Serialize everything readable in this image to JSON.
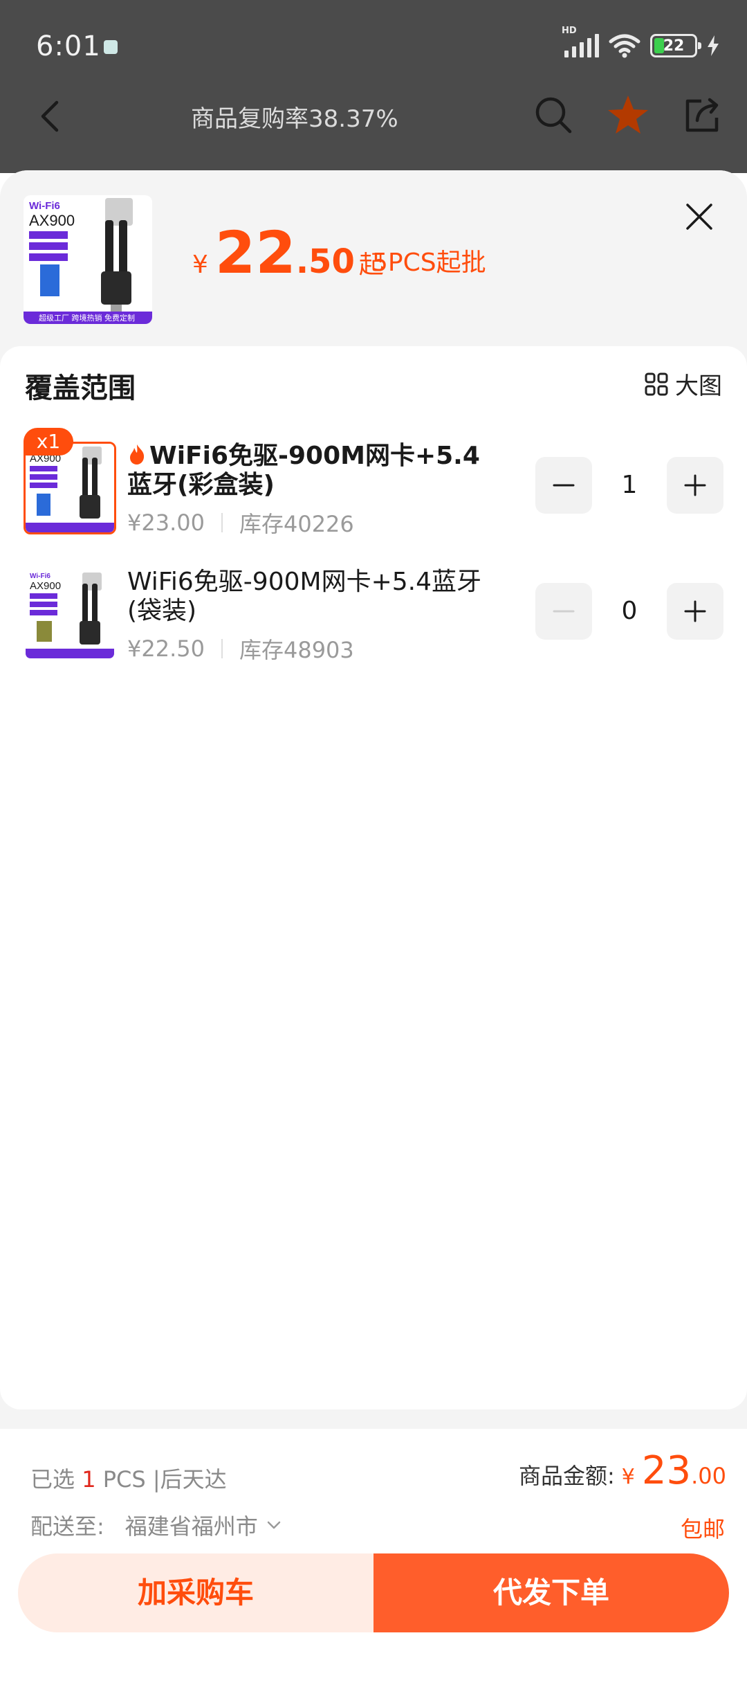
{
  "status_bar": {
    "time": "6:01",
    "battery": "22",
    "network": "HD"
  },
  "nav": {
    "title": "商品复购率38.37%"
  },
  "header": {
    "currency": "¥",
    "price_int": "22",
    "price_dec": ".50",
    "price_suffix": "起",
    "moq": "5PCS起批"
  },
  "section": {
    "title": "覆盖范围",
    "big_view_label": "大图"
  },
  "skus": [
    {
      "badge": "x1",
      "name": "WiFi6免驱-900M网卡+5.4蓝牙(彩盒装)",
      "price": "¥23.00",
      "stock": "库存40226",
      "quantity": "1",
      "hot": true
    },
    {
      "name": "WiFi6免驱-900M网卡+5.4蓝牙(袋装)",
      "price": "¥22.50",
      "stock": "库存48903",
      "quantity": "0",
      "hot": false
    }
  ],
  "thumb_text": {
    "brand": "Wi-Fi6",
    "model": "AX900",
    "footer": "超级工厂 跨境热销 免费定制"
  },
  "footer": {
    "selected_prefix": "已选",
    "selected_count": "1",
    "selected_suffix": "PCS |后天达",
    "amount_label": "商品金额:",
    "currency": "¥",
    "amount_int": "23",
    "amount_dec": ".00",
    "ship_label": "配送至:",
    "ship_address": "福建省福州市",
    "free_shipping": "包邮",
    "add_cart_label": "加采购车",
    "order_label": "代发下单"
  },
  "colors": {
    "accent": "#ff4d0d",
    "accent_light": "#ffece4",
    "order_button": "#ff5e2b",
    "star": "#b33a00"
  }
}
